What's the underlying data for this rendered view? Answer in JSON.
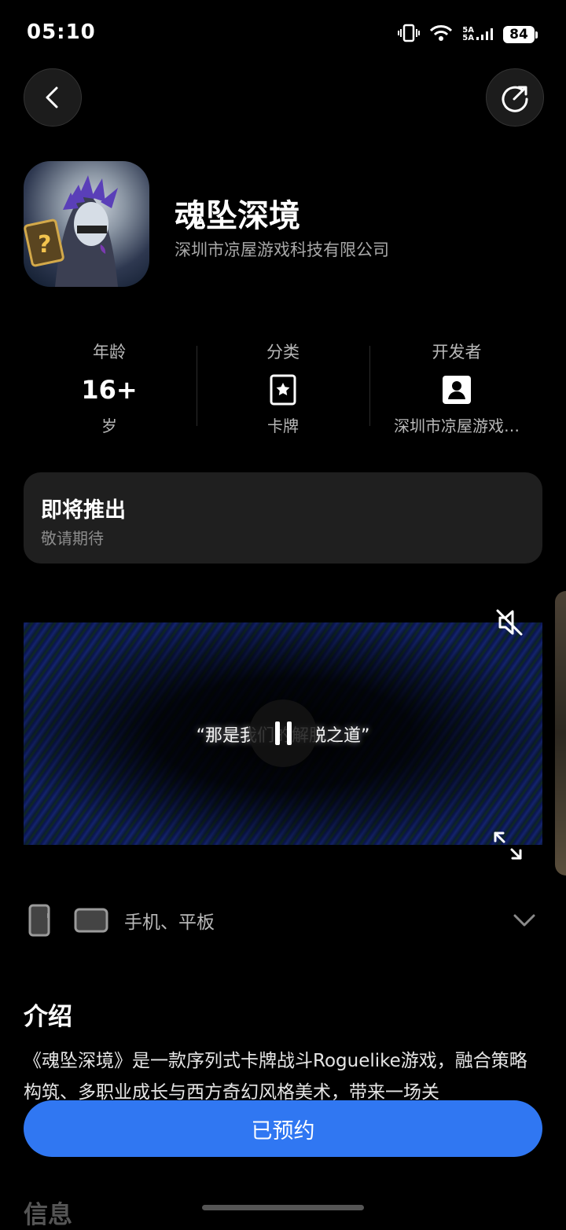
{
  "status_bar": {
    "time": "05:10",
    "signal_label_1": "5A",
    "signal_label_2": "5A",
    "battery": "84"
  },
  "app": {
    "name": "魂坠深境",
    "developer": "深圳市凉屋游戏科技有限公司"
  },
  "info": {
    "age": {
      "label": "年龄",
      "value": "16+",
      "unit": "岁"
    },
    "category": {
      "label": "分类",
      "value": "卡牌"
    },
    "developer": {
      "label": "开发者",
      "value": "深圳市凉屋游戏…"
    }
  },
  "release": {
    "title": "即将推出",
    "subtitle": "敬请期待"
  },
  "video": {
    "caption": "“那是我们的解脱之道”"
  },
  "devices": {
    "text": "手机、平板"
  },
  "intro": {
    "heading": "介绍",
    "text": "《魂坠深境》是一款序列式卡牌战斗Roguelike游戏，融合策略构筑、多职业成长与西方奇幻风格美术，带来一场关"
  },
  "info_section": {
    "heading": "信息"
  },
  "actions": {
    "reserve_label": "已预约"
  }
}
